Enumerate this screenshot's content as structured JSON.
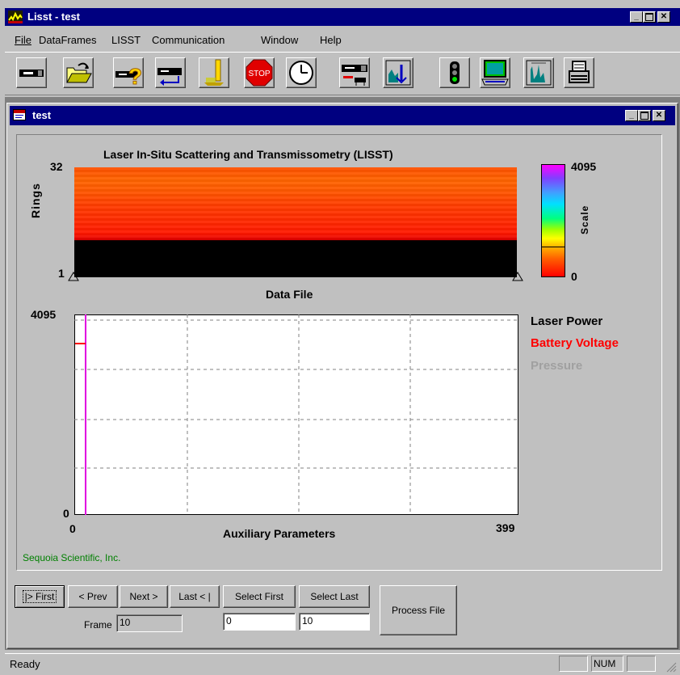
{
  "app": {
    "title": "Lisst - test",
    "menu": [
      "File",
      "DataFrames",
      "LISST",
      "Communication",
      "Window",
      "Help"
    ]
  },
  "toolbar": {
    "buttons": [
      "instrument-connect",
      "open-folder",
      "query-instrument",
      "offload-data",
      "depth-probe",
      "stop",
      "clock",
      "instrument-settings",
      "view-histogram",
      "status-light",
      "computer-terminal",
      "spectrum-display",
      "printer"
    ]
  },
  "child_window": {
    "title": "test"
  },
  "rings_plot": {
    "title": "Laser In-Situ Scattering and Transmissometry (LISST)",
    "y_label": "Rings",
    "y_top": "32",
    "y_bottom": "1",
    "x_label": "Data File",
    "scale_label": "Scale",
    "scale_max": "4095",
    "scale_min": "0"
  },
  "aux_plot": {
    "y_max": "4095",
    "y_min": "0",
    "x_min": "0",
    "x_max": "399",
    "x_label": "Auxiliary Parameters",
    "legend": [
      {
        "name": "Laser Power",
        "color": "#000000"
      },
      {
        "name": "Battery Voltage",
        "color": "#ff0000"
      },
      {
        "name": "Pressure",
        "color": "#a0a0a0"
      }
    ]
  },
  "credit": "Sequoia Scientific, Inc.",
  "nav": {
    "first": "|> First",
    "prev": "< Prev",
    "next": "Next >",
    "last": "Last < |",
    "select_first": "Select First",
    "select_last": "Select Last",
    "process": "Process File",
    "frame_label": "Frame",
    "frame_value": "10",
    "select_first_value": "0",
    "select_last_value": "10"
  },
  "status": {
    "text": "Ready",
    "num": "NUM"
  }
}
